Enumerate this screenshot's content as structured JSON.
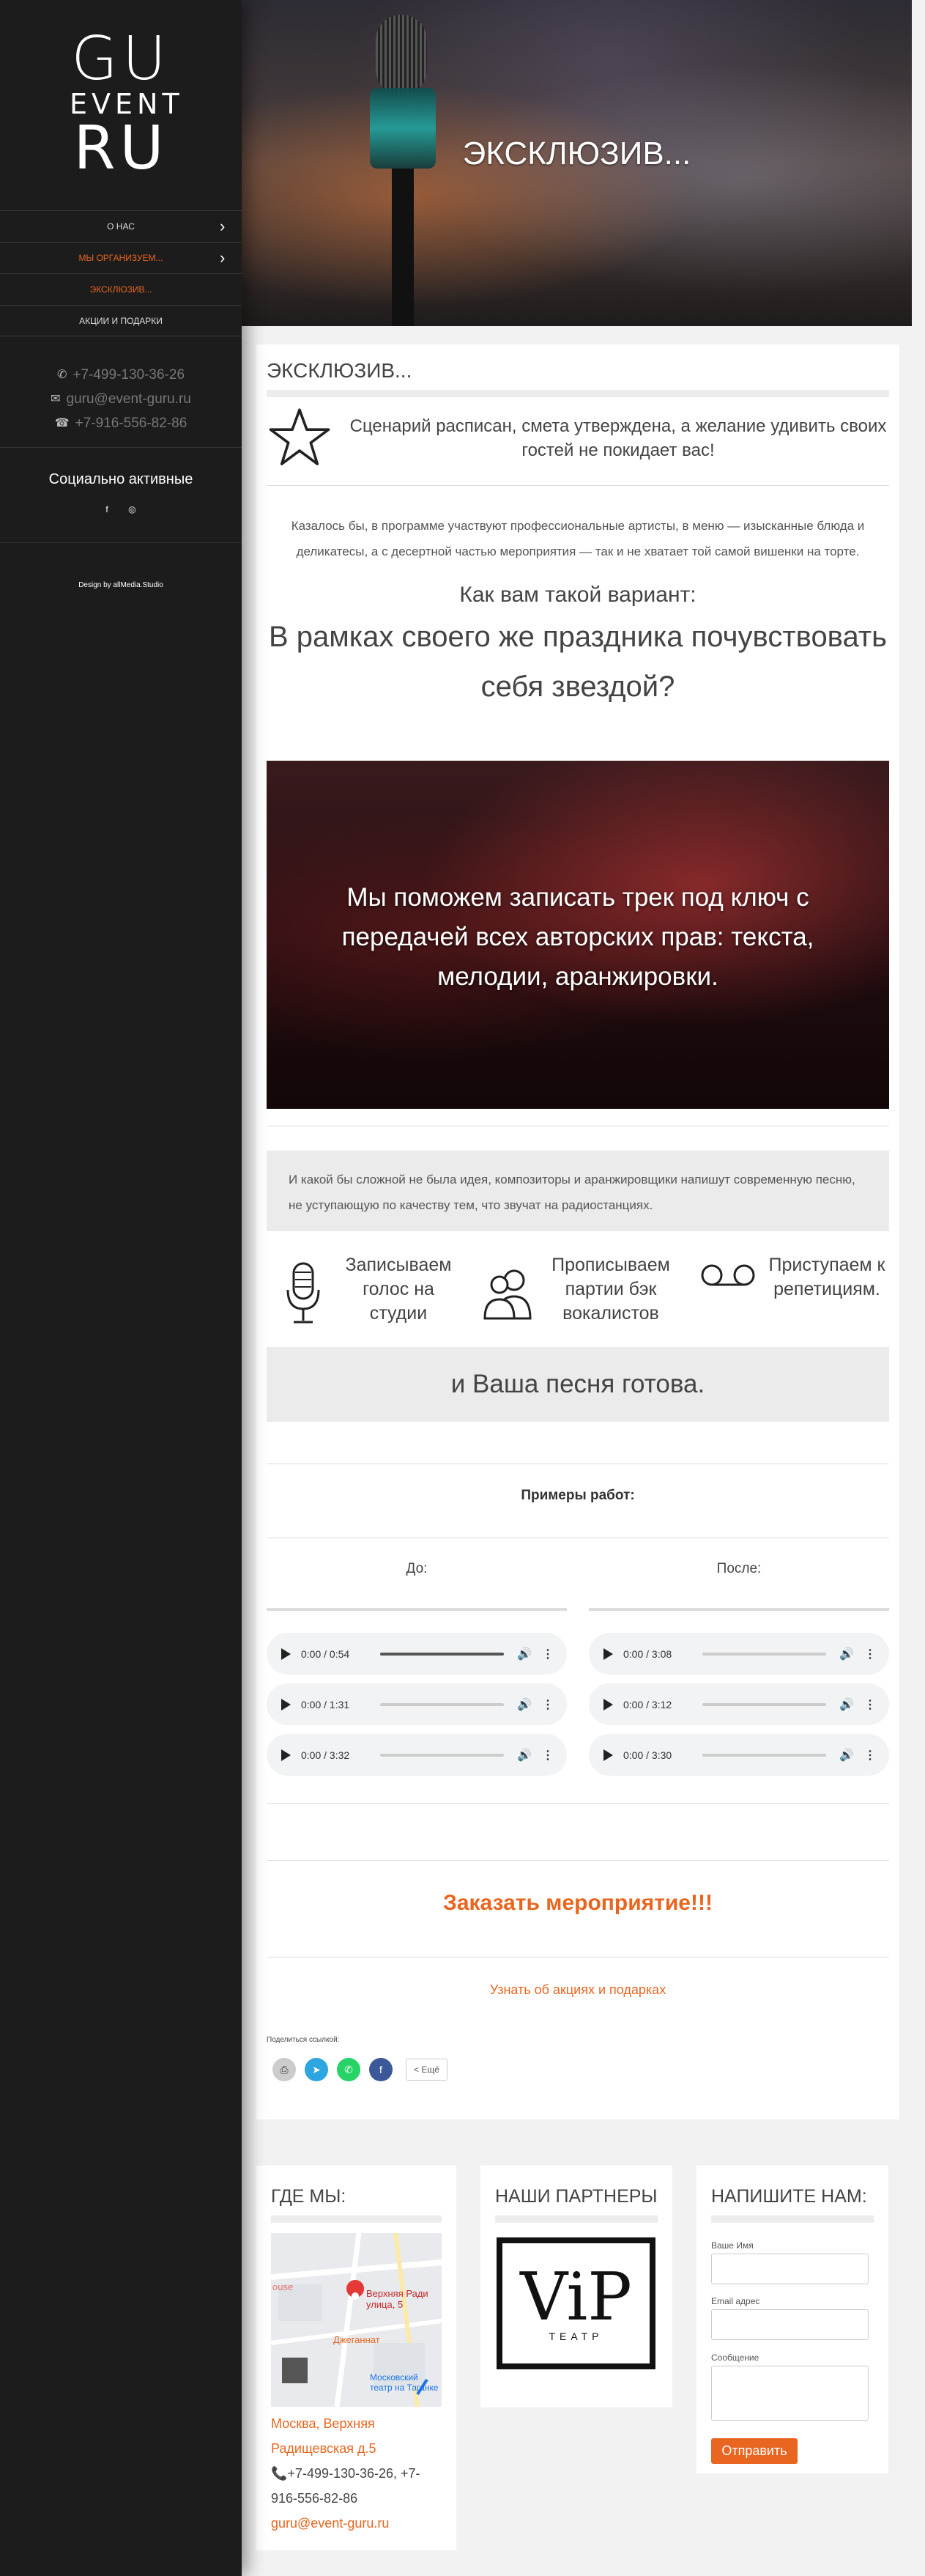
{
  "logo": {
    "line1": "GU",
    "line2": "EVENT",
    "line3": "RU"
  },
  "menu": [
    {
      "label": "О НАС",
      "has_chevron": true,
      "active": false
    },
    {
      "label": "МЫ ОРГАНИЗУЕМ...",
      "has_chevron": true,
      "active": true
    },
    {
      "label": "ЭКСКЛЮЗИВ...",
      "has_chevron": false,
      "active": true
    },
    {
      "label": "АКЦИИ И ПОДАРКИ",
      "has_chevron": false,
      "active": false
    }
  ],
  "contacts": {
    "phone1": "+7-499-130-36-26",
    "email": "guru@event-guru.ru",
    "phone2": "+7-916-556-82-86"
  },
  "social": {
    "title": "Социально активные",
    "icons": [
      "facebook-icon",
      "instagram-icon"
    ]
  },
  "credit": "Design by allMedia.Studio",
  "hero": {
    "title": "ЭКСКЛЮЗИВ..."
  },
  "content": {
    "page_title": "ЭКСКЛЮЗИВ...",
    "intro": "Сценарий расписан, смета утверждена, а желание удивить своих гостей не покидает вас!",
    "paragraph": "Казалось бы, в программе участвуют профессиональные артисты, в меню — изысканные блюда и деликатесы, а с десертной частью мероприятия — так и не хватает той самой вишенки на торте.",
    "question1": "Как вам такой вариант:",
    "question2": "В рамках своего же праздника почувствовать себя звездой?",
    "video_text": "Мы поможем записать трек под ключ с передачей  всех авторских прав: текста, мелодии, аранжировки.",
    "note": "И какой бы сложной не была  идея, композиторы и аранжировщики  напишут современную песню, не уступающую по качеству тем, что звучат на радиостанциях.",
    "steps": [
      {
        "icon": "microphone-icon",
        "label": "Записываем голос на студии"
      },
      {
        "icon": "singers-icon",
        "label": "Прописываем партии бэк вокалистов"
      },
      {
        "icon": "tape-icon",
        "label": "Приступаем к репетициям."
      }
    ],
    "ready": "и Ваша песня готова.",
    "examples_title": "Примеры работ:",
    "before_label": "До:",
    "after_label": "После:",
    "before_audio": [
      {
        "time": "0:00 / 0:54",
        "progress": 1.0
      },
      {
        "time": "0:00 / 1:31",
        "progress": 0.0
      },
      {
        "time": "0:00 / 3:32",
        "progress": 0.0
      }
    ],
    "after_audio": [
      {
        "time": "0:00 / 3:08",
        "progress": 0.0
      },
      {
        "time": "0:00 / 3:12",
        "progress": 0.0
      },
      {
        "time": "0:00 / 3:30",
        "progress": 0.0
      }
    ],
    "order": "Заказать мероприятие!!!",
    "promo_link": "Узнать об акциях и подарках",
    "share_label": "Поделиться ссылкой:",
    "share_more": "Ещё"
  },
  "footer": {
    "where_title": "ГДЕ МЫ:",
    "map_labels": {
      "pin": "Верхняя Ради\nулица, 5",
      "theatre": "Московский\nтеатр на Таганке",
      "shop": "Джеганнат",
      "mouse": "ouse"
    },
    "address": "Москва, Верхняя Радищевская д.5",
    "phones": "+7-499-130-36-26, +7-916-556-82-86",
    "email": "guru@event-guru.ru",
    "partners_title": "НАШИ ПАРТНЕРЫ",
    "partner_logo": {
      "main": "ViP",
      "sub": "ТЕАТР"
    },
    "write_title": "НАПИШИТЕ НАМ:",
    "form": {
      "name_label": "Ваше Имя",
      "email_label": "Email адрес",
      "message_label": "Сообщение",
      "submit": "Отправить"
    }
  },
  "colors": {
    "accent": "#e8661f",
    "sidebar": "#1c1c1c",
    "panel": "#ebebeb"
  }
}
